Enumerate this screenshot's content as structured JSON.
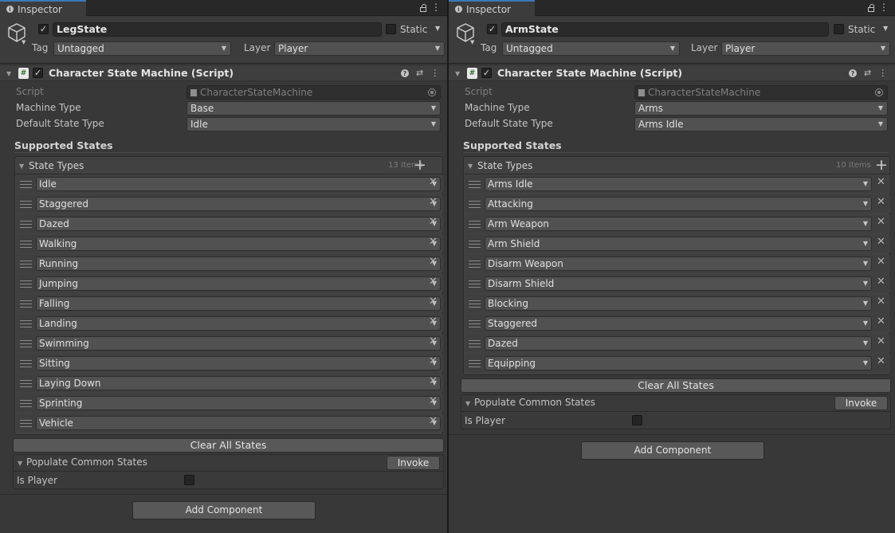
{
  "panels": [
    {
      "id": "left",
      "tab_label": "Inspector",
      "object_name": "LegState",
      "static_label": "Static",
      "tag_label": "Tag",
      "tag_value": "Untagged",
      "layer_label": "Layer",
      "layer_value": "Player",
      "component_title": "Character State Machine (Script)",
      "script_label": "Script",
      "script_value": "CharacterStateMachine",
      "machine_type_label": "Machine Type",
      "machine_type_value": "Base",
      "default_state_label": "Default State Type",
      "default_state_value": "Idle",
      "supported_states_title": "Supported States",
      "state_types_title": "State Types",
      "item_count": "13 Items",
      "states": [
        "Idle",
        "Staggered",
        "Dazed",
        "Walking",
        "Running",
        "Jumping",
        "Falling",
        "Landing",
        "Swimming",
        "Sitting",
        "Laying Down",
        "Sprinting",
        "Vehicle"
      ],
      "clear_all_label": "Clear All States",
      "populate_label": "Populate Common States",
      "invoke_label": "Invoke",
      "is_player_label": "Is Player",
      "add_component_label": "Add Component"
    },
    {
      "id": "right",
      "tab_label": "Inspector",
      "object_name": "ArmState",
      "static_label": "Static",
      "tag_label": "Tag",
      "tag_value": "Untagged",
      "layer_label": "Layer",
      "layer_value": "Player",
      "component_title": "Character State Machine (Script)",
      "script_label": "Script",
      "script_value": "CharacterStateMachine",
      "machine_type_label": "Machine Type",
      "machine_type_value": "Arms",
      "default_state_label": "Default State Type",
      "default_state_value": "Arms Idle",
      "supported_states_title": "Supported States",
      "state_types_title": "State Types",
      "item_count": "10 Items",
      "states": [
        "Arms Idle",
        "Attacking",
        "Arm Weapon",
        "Arm Shield",
        "Disarm Weapon",
        "Disarm Shield",
        "Blocking",
        "Staggered",
        "Dazed",
        "Equipping"
      ],
      "clear_all_label": "Clear All States",
      "populate_label": "Populate Common States",
      "invoke_label": "Invoke",
      "is_player_label": "Is Player",
      "add_component_label": "Add Component"
    }
  ],
  "colors": {
    "panel_bg": "#383838",
    "header_bg": "#3c3c3c",
    "field_bg": "#515151",
    "tab_accent": "#3a79bb"
  },
  "icons": {
    "tab": "info-icon",
    "lock": "lock-icon",
    "menu": "kebab-icon",
    "object": "cube-icon",
    "component": "csharp-script-icon",
    "help": "help-icon",
    "presets": "sliders-icon",
    "drag": "grip-icon",
    "remove": "remove-icon",
    "add": "plus-icon"
  }
}
